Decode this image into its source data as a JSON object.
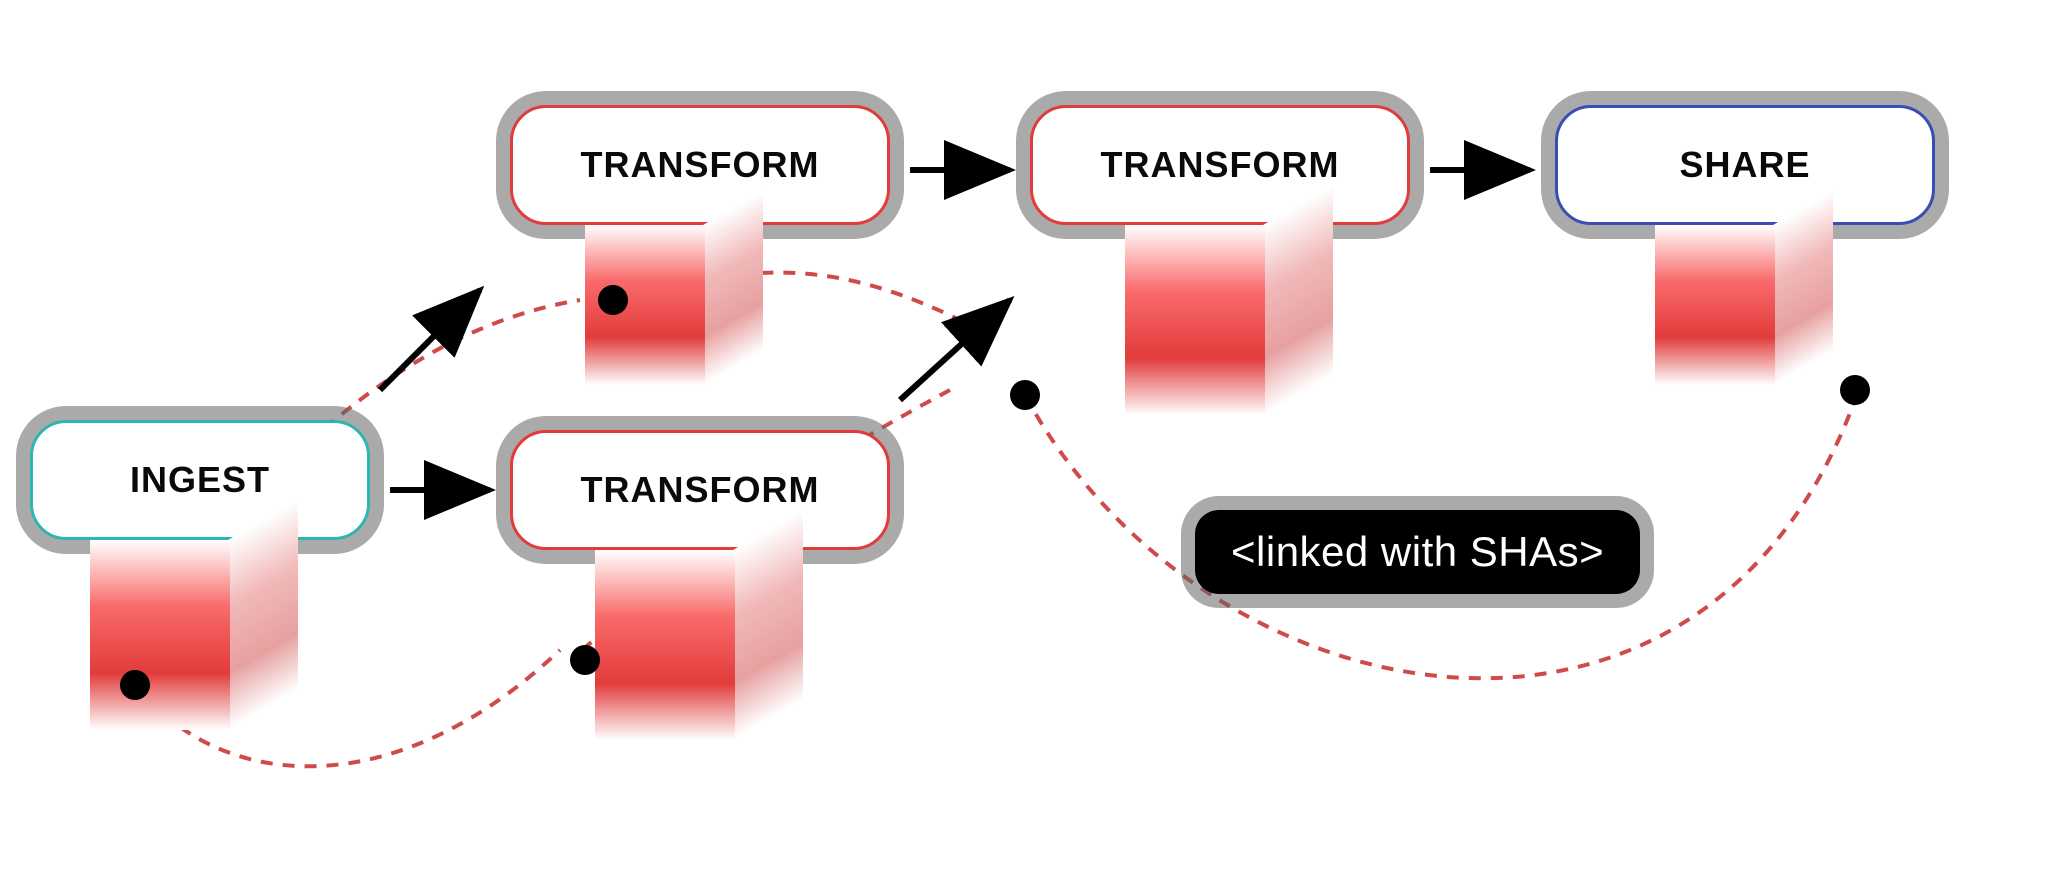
{
  "nodes": {
    "ingest": {
      "label": "INGEST"
    },
    "transform_top": {
      "label": "TRANSFORM"
    },
    "transform_bottom": {
      "label": "TRANSFORM"
    },
    "transform_right": {
      "label": "TRANSFORM"
    },
    "share": {
      "label": "SHARE"
    }
  },
  "annotation": {
    "label": "<linked with SHAs>"
  },
  "colors": {
    "red_accent": "#e23b3b",
    "teal_accent": "#2fb5b0",
    "blue_accent": "#3a4db3",
    "dashed": "#cf4b4b"
  }
}
